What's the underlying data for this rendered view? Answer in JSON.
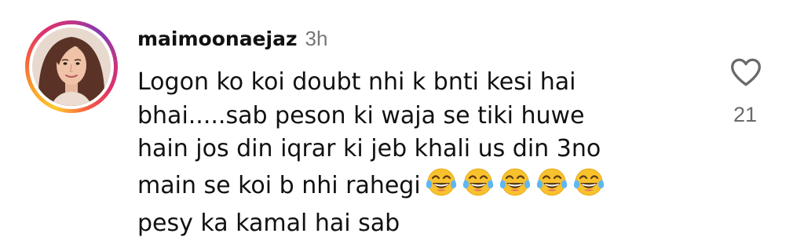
{
  "comment": {
    "username": "maimoonaejaz",
    "time": "3h",
    "lines": [
      "Logon ko koi doubt nhi k bnti kesi hai",
      "bhai.....sab peson ki waja se tiki huwe",
      "hain jos din iqrar ki jeb khali us din 3no",
      "main se koi b nhi rahegi",
      "pesy ka kamal hai sab"
    ],
    "emojis": [
      "face-with-tears-of-joy",
      "face-with-tears-of-joy",
      "face-with-tears-of-joy",
      "face-with-tears-of-joy",
      "face-with-tears-of-joy"
    ],
    "like_count": "21"
  },
  "icons": {
    "like": "heart-outline-icon",
    "emoji": "face-with-tears-of-joy"
  },
  "colors": {
    "text": "#111111",
    "muted": "#777777",
    "like_count": "#6a6a6a",
    "story_ring": [
      "#fdc830",
      "#f56040",
      "#e1306c",
      "#c13584",
      "#833ab4"
    ]
  }
}
